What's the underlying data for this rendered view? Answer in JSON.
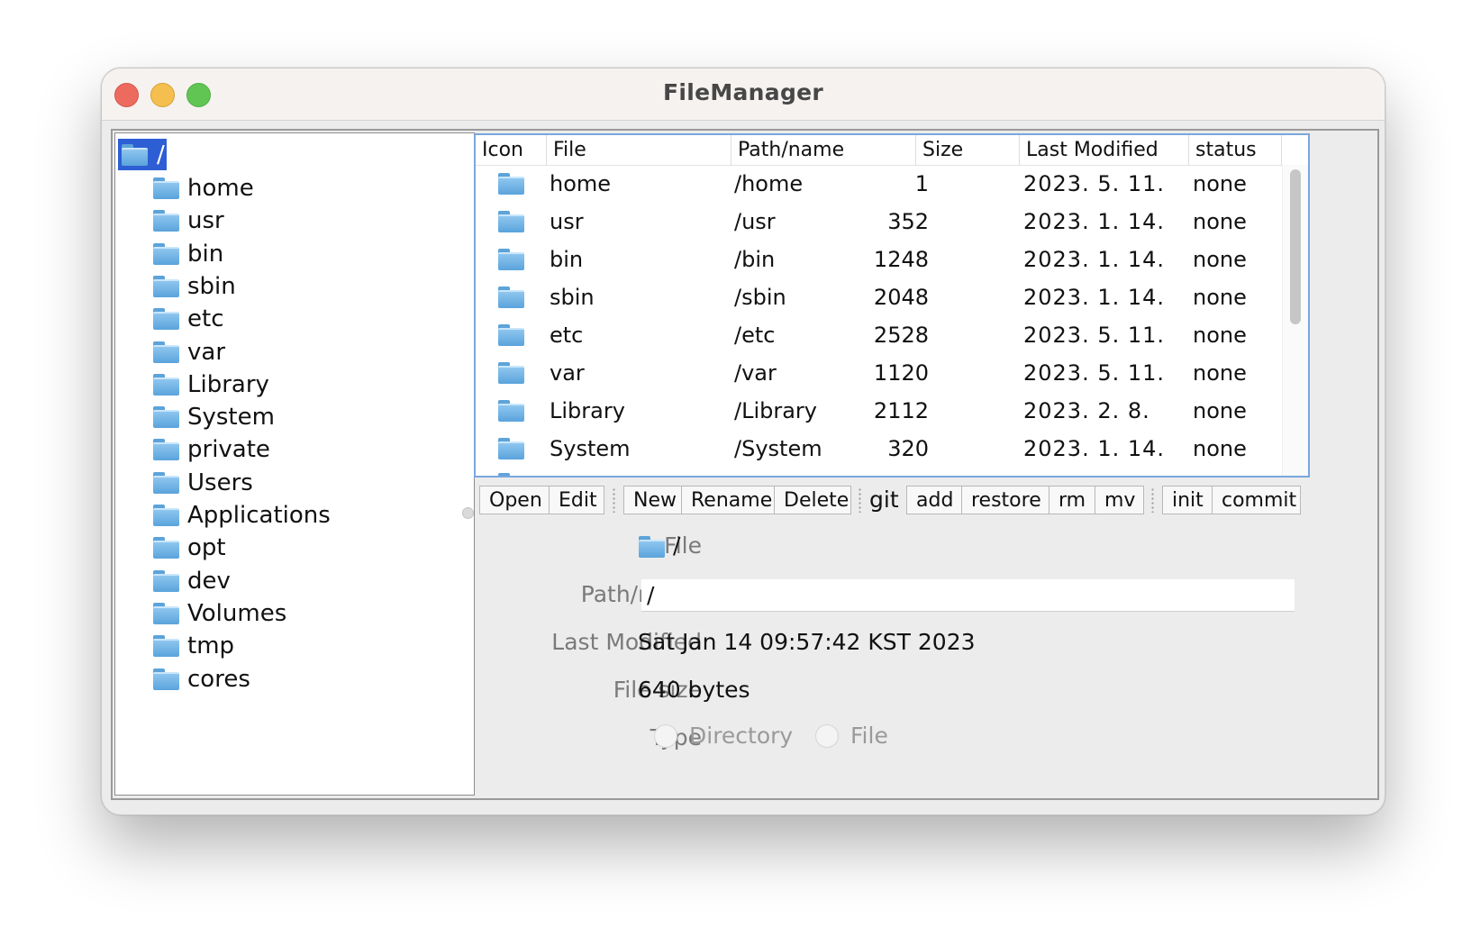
{
  "window": {
    "title": "FileManager"
  },
  "tree": {
    "root": "/",
    "items": [
      "home",
      "usr",
      "bin",
      "sbin",
      "etc",
      "var",
      "Library",
      "System",
      "private",
      "Users",
      "Applications",
      "opt",
      "dev",
      "Volumes",
      "tmp",
      "cores"
    ]
  },
  "table": {
    "columns": [
      "Icon",
      "File",
      "Path/name",
      "Size",
      "Last Modified",
      "status"
    ],
    "rows": [
      {
        "file": "home",
        "path": "/home",
        "size": "1",
        "modified": "2023. 5. 11.",
        "status": "none"
      },
      {
        "file": "usr",
        "path": "/usr",
        "size": "352",
        "modified": "2023. 1. 14.",
        "status": "none"
      },
      {
        "file": "bin",
        "path": "/bin",
        "size": "1248",
        "modified": "2023. 1. 14.",
        "status": "none"
      },
      {
        "file": "sbin",
        "path": "/sbin",
        "size": "2048",
        "modified": "2023. 1. 14.",
        "status": "none"
      },
      {
        "file": "etc",
        "path": "/etc",
        "size": "2528",
        "modified": "2023. 5. 11.",
        "status": "none"
      },
      {
        "file": "var",
        "path": "/var",
        "size": "1120",
        "modified": "2023. 5. 11.",
        "status": "none"
      },
      {
        "file": "Library",
        "path": "/Library",
        "size": "2112",
        "modified": "2023. 2. 8.",
        "status": "none"
      },
      {
        "file": "System",
        "path": "/System",
        "size": "320",
        "modified": "2023. 1. 14.",
        "status": "none"
      }
    ]
  },
  "toolbar": {
    "open": "Open",
    "edit": "Edit",
    "new": "New",
    "rename": "Rename",
    "delete": "Delete",
    "git_label": "git",
    "add": "add",
    "restore": "restore",
    "rm": "rm",
    "mv": "mv",
    "init": "init",
    "commit": "commit"
  },
  "details": {
    "file_label": "File",
    "file_value": "/",
    "path_label": "Path/name",
    "path_value": "/",
    "modified_label": "Last Modified",
    "modified_value": "Sat Jan 14 09:57:42 KST 2023",
    "size_label": "File size",
    "size_value": "640 bytes",
    "type_label": "Type",
    "type_directory": "Directory",
    "type_file": "File"
  },
  "colors": {
    "selection": "#2d5ed4",
    "table_border": "#7aa7de",
    "folder": "#5aa3dc"
  }
}
